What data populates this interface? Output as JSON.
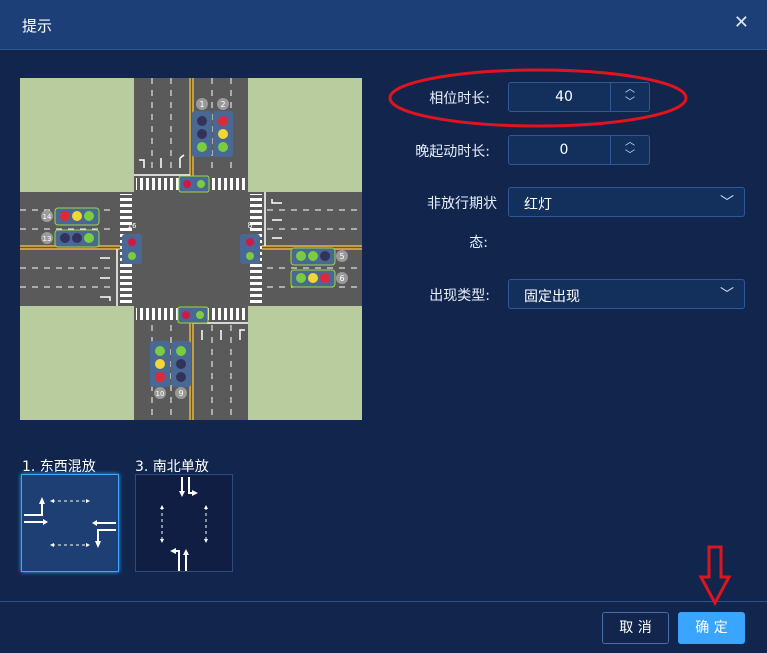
{
  "dialog": {
    "title": "提示",
    "close_glyph": "✕"
  },
  "intersection": {
    "signal_numbers": [
      "1",
      "2",
      "3",
      "4",
      "5",
      "6",
      "7",
      "8",
      "9",
      "10",
      "13",
      "14",
      "15",
      "16"
    ]
  },
  "form": {
    "phase_duration": {
      "label": "相位时长:",
      "value": "40"
    },
    "late_start": {
      "label": "晚起动时长:",
      "value": "0"
    },
    "non_release_state": {
      "label_line1": "非放行期状",
      "label_line2": "态:",
      "value": "红灯"
    },
    "appear_type": {
      "label": "出现类型:",
      "value": "固定出现"
    },
    "spin_up": "︿",
    "spin_down": "﹀",
    "chevron": "﹀"
  },
  "phases": [
    {
      "label": "1. 东西混放",
      "selected": true
    },
    {
      "label": "3. 南北单放",
      "selected": false
    }
  ],
  "buttons": {
    "cancel": "取 消",
    "confirm": "确 定"
  },
  "colors": {
    "accent": "#3aa5ff",
    "annotation": "#e0141e",
    "header": "#1c3f78",
    "background": "#12264d"
  }
}
